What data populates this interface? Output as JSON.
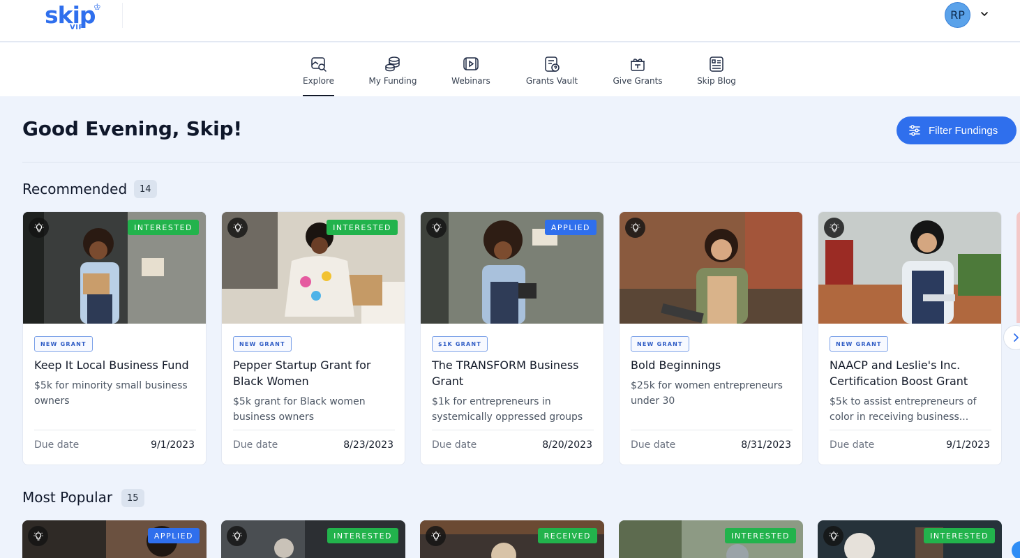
{
  "header": {
    "logo_text": "skip",
    "logo_sub": "VIP",
    "avatar_initials": "RP"
  },
  "nav": {
    "items": [
      {
        "label": "Explore",
        "icon": "explore-icon",
        "active": true
      },
      {
        "label": "My Funding",
        "icon": "coins-icon",
        "active": false
      },
      {
        "label": "Webinars",
        "icon": "video-icon",
        "active": false
      },
      {
        "label": "Grants Vault",
        "icon": "vault-icon",
        "active": false
      },
      {
        "label": "Give Grants",
        "icon": "gift-icon",
        "active": false
      },
      {
        "label": "Skip Blog",
        "icon": "blog-icon",
        "active": false
      }
    ]
  },
  "main": {
    "greeting": "Good Evening, Skip!",
    "filter_button": "Filter Fundings"
  },
  "recommended": {
    "title": "Recommended",
    "count": "14",
    "cards": [
      {
        "status": "INTERESTED",
        "tag": "NEW GRANT",
        "title": "Keep It Local Business Fund",
        "description": "$5k for minority small business owners",
        "due_label": "Due date",
        "due_date": "9/1/2023"
      },
      {
        "status": "INTERESTED",
        "tag": "NEW GRANT",
        "title": "Pepper Startup Grant for Black Women",
        "description": "$5k grant for Black women business owners",
        "due_label": "Due date",
        "due_date": "8/23/2023"
      },
      {
        "status": "APPLIED",
        "tag": "$1K GRANT",
        "title": "The TRANSFORM Business Grant",
        "description": "$1k for entrepreneurs in systemically oppressed groups",
        "due_label": "Due date",
        "due_date": "8/20/2023"
      },
      {
        "status": "",
        "tag": "NEW GRANT",
        "title": "Bold Beginnings",
        "description": "$25k for women entrepreneurs under 30",
        "due_label": "Due date",
        "due_date": "8/31/2023"
      },
      {
        "status": "",
        "tag": "NEW GRANT",
        "title": "NAACP and Leslie's Inc. Certification Boost Grant",
        "description": "$5k to assist entrepreneurs of color in receiving business...",
        "due_label": "Due date",
        "due_date": "9/1/2023"
      }
    ]
  },
  "most_popular": {
    "title": "Most Popular",
    "count": "15",
    "cards": [
      {
        "status": "APPLIED"
      },
      {
        "status": "INTERESTED"
      },
      {
        "status": "RECEIVED"
      },
      {
        "status": "INTERESTED"
      },
      {
        "status": "INTERESTED"
      }
    ]
  },
  "colors": {
    "brand": "#2f6fed",
    "interested": "#22b34c",
    "applied": "#2f6fed",
    "received": "#22b34c",
    "page_bg": "#eef3fc"
  }
}
